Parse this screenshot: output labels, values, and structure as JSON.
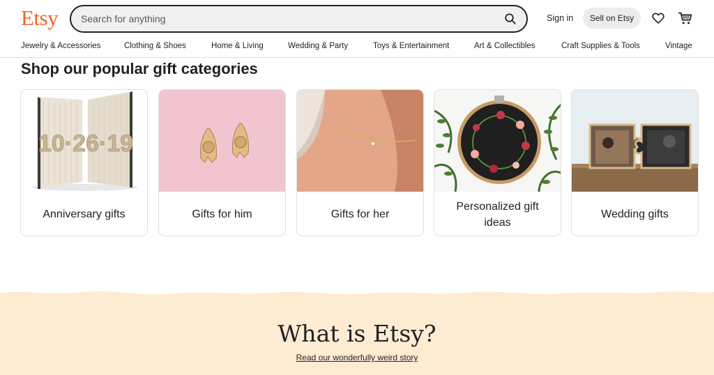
{
  "header": {
    "logo": "Etsy",
    "search_placeholder": "Search for anything",
    "sign_in": "Sign in",
    "sell": "Sell on Etsy",
    "icons": [
      "search-icon",
      "heart-icon",
      "cart-icon"
    ]
  },
  "nav": [
    "Jewelry & Accessories",
    "Clothing & Shoes",
    "Home & Living",
    "Wedding & Party",
    "Toys & Entertainment",
    "Art & Collectibles",
    "Craft Supplies & Tools",
    "Vintage"
  ],
  "gifts": {
    "title": "Shop our popular gift categories",
    "cards": [
      "Anniversary gifts",
      "Gifts for him",
      "Gifts for her",
      "Personalized gift ideas",
      "Wedding gifts"
    ]
  },
  "about": {
    "title": "What is Etsy?",
    "link": "Read our wonderfully weird story"
  },
  "colors": {
    "brand": "#F1641E",
    "cream": "#FDEBD2",
    "pink": "#F1C5D0"
  }
}
